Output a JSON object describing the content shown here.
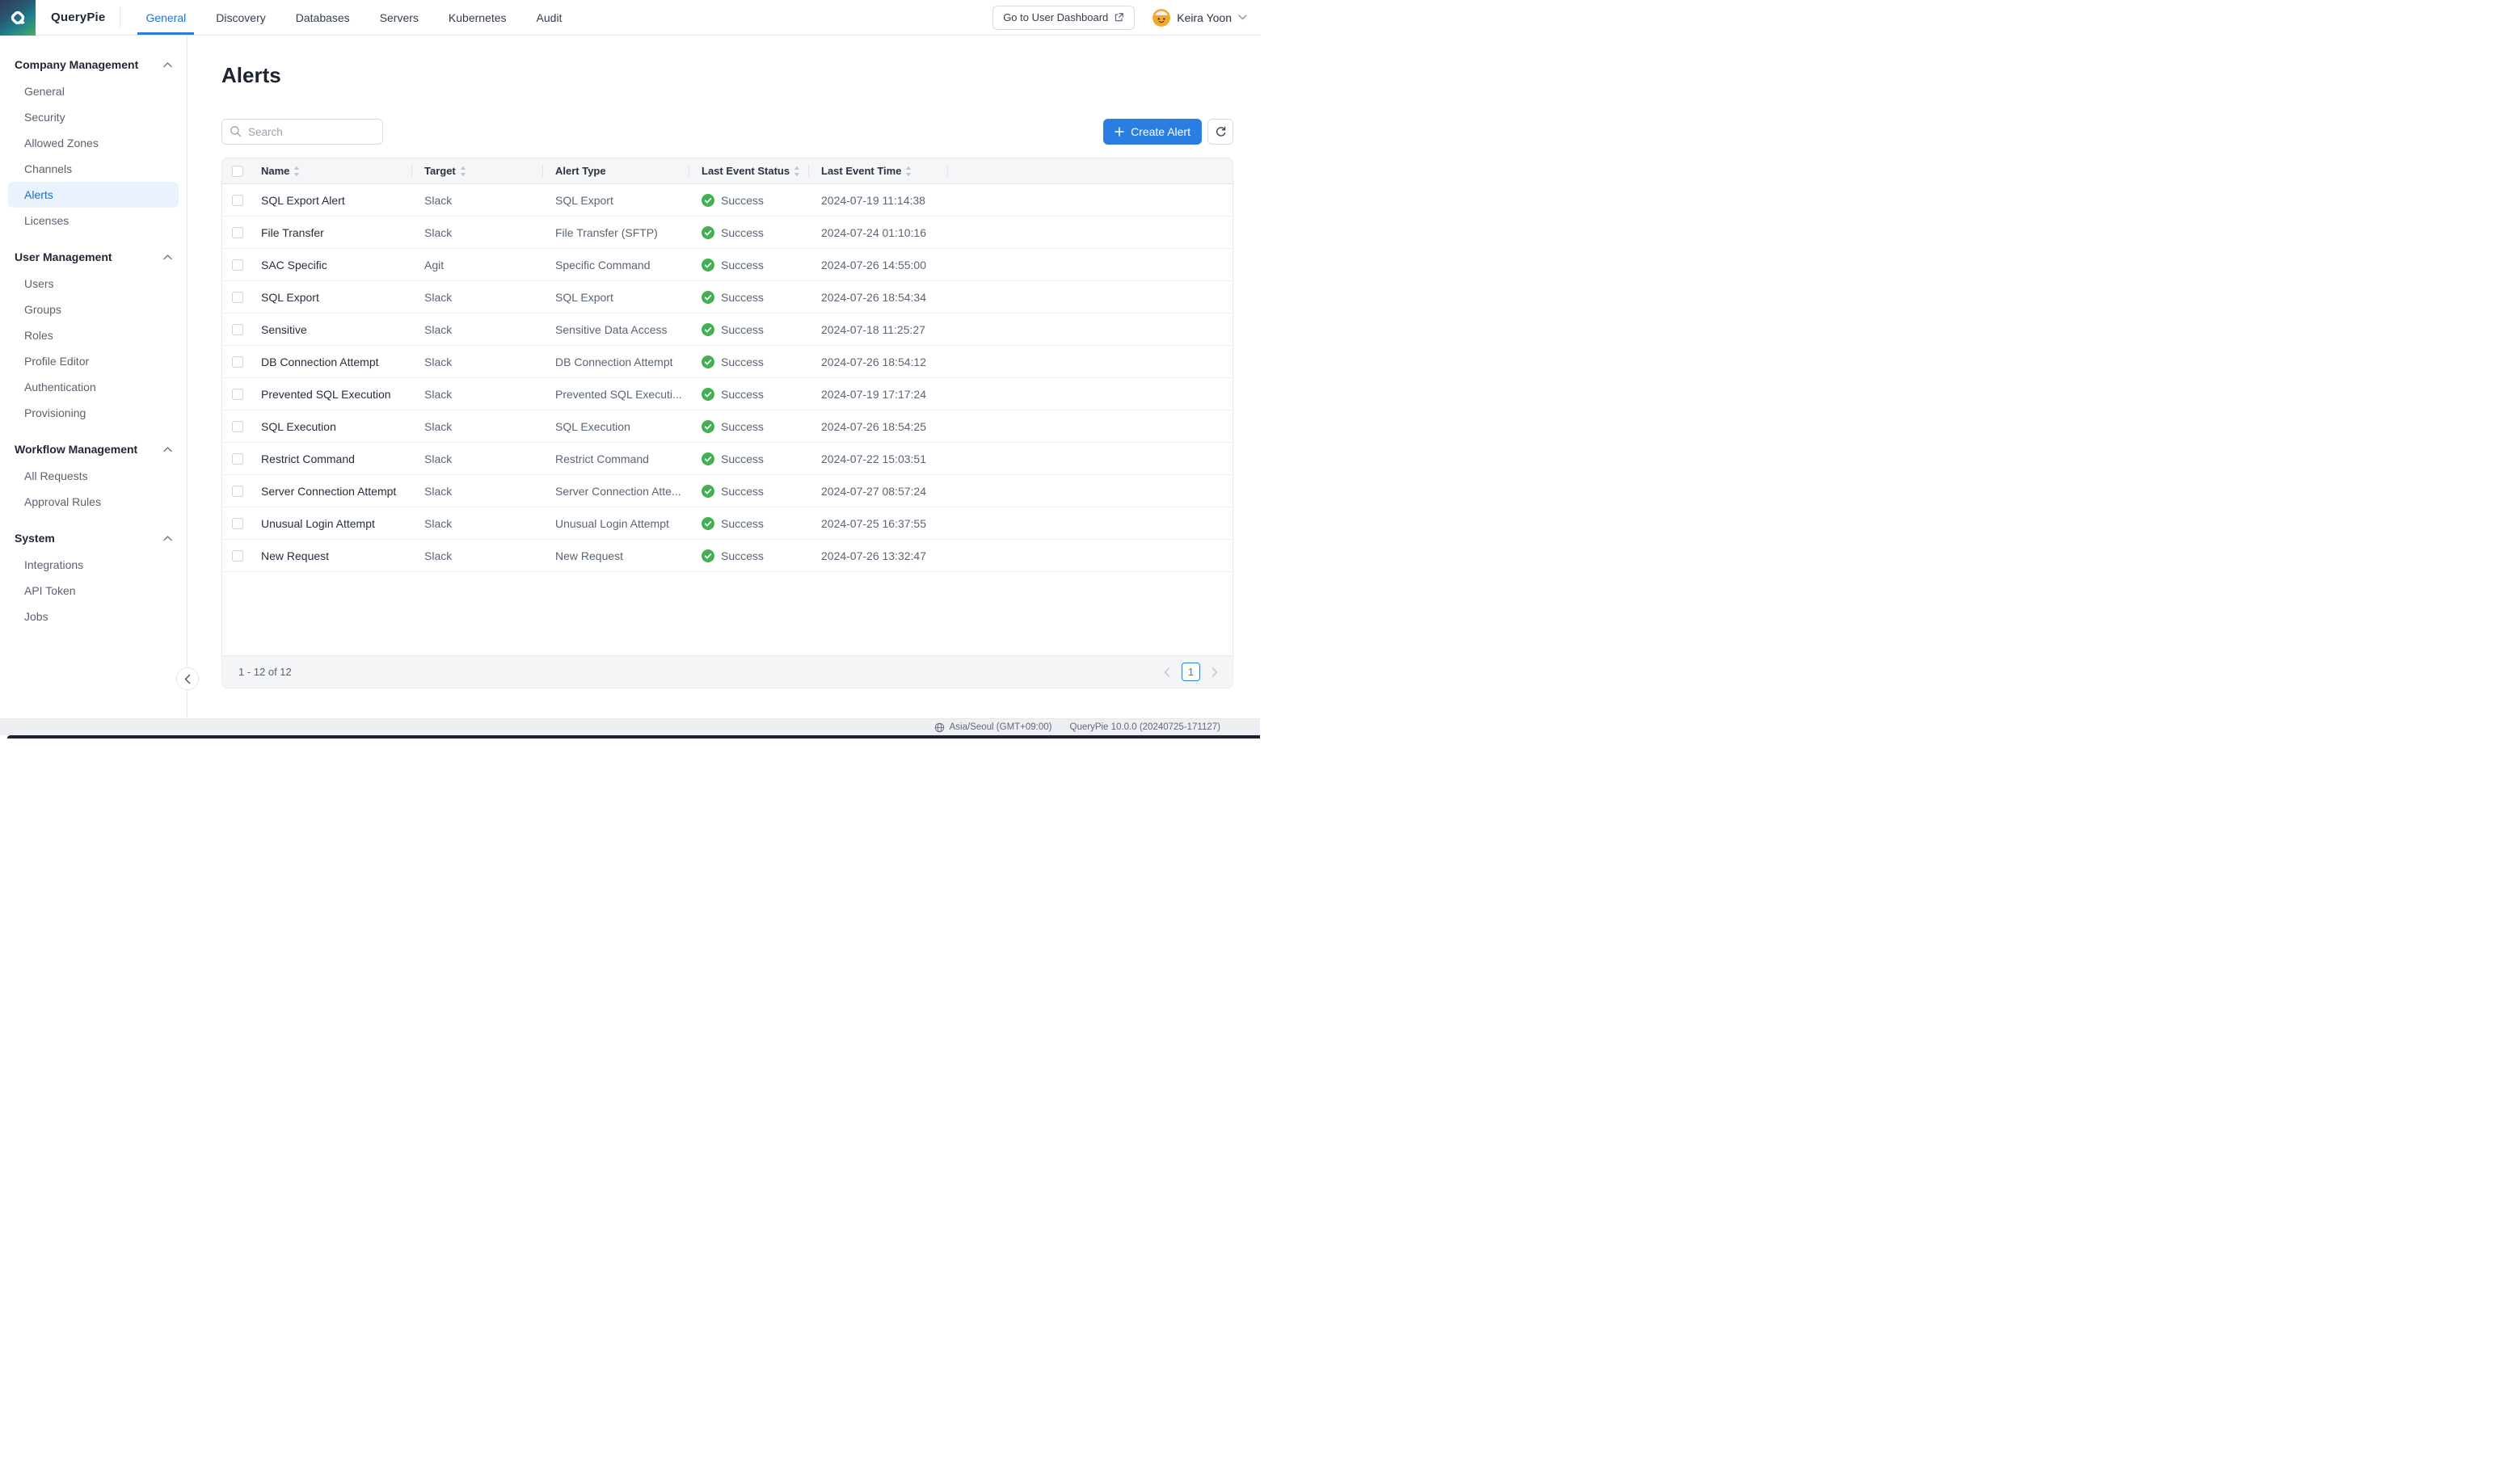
{
  "topbar": {
    "brand": "QueryPie",
    "nav": [
      {
        "label": "General",
        "active": true
      },
      {
        "label": "Discovery",
        "active": false
      },
      {
        "label": "Databases",
        "active": false
      },
      {
        "label": "Servers",
        "active": false
      },
      {
        "label": "Kubernetes",
        "active": false
      },
      {
        "label": "Audit",
        "active": false
      }
    ],
    "dashboard_button": "Go to User Dashboard",
    "user_name": "Keira Yoon"
  },
  "sidebar": {
    "sections": [
      {
        "label": "Company Management",
        "items": [
          {
            "label": "General",
            "active": false
          },
          {
            "label": "Security",
            "active": false
          },
          {
            "label": "Allowed Zones",
            "active": false
          },
          {
            "label": "Channels",
            "active": false
          },
          {
            "label": "Alerts",
            "active": true
          },
          {
            "label": "Licenses",
            "active": false
          }
        ]
      },
      {
        "label": "User Management",
        "items": [
          {
            "label": "Users",
            "active": false
          },
          {
            "label": "Groups",
            "active": false
          },
          {
            "label": "Roles",
            "active": false
          },
          {
            "label": "Profile Editor",
            "active": false
          },
          {
            "label": "Authentication",
            "active": false
          },
          {
            "label": "Provisioning",
            "active": false
          }
        ]
      },
      {
        "label": "Workflow Management",
        "items": [
          {
            "label": "All Requests",
            "active": false
          },
          {
            "label": "Approval Rules",
            "active": false
          }
        ]
      },
      {
        "label": "System",
        "items": [
          {
            "label": "Integrations",
            "active": false
          },
          {
            "label": "API Token",
            "active": false
          },
          {
            "label": "Jobs",
            "active": false
          }
        ]
      }
    ]
  },
  "main": {
    "title": "Alerts",
    "search_placeholder": "Search",
    "create_button_label": "Create Alert",
    "table": {
      "columns": [
        {
          "label": "Name",
          "sortable": true
        },
        {
          "label": "Target",
          "sortable": true
        },
        {
          "label": "Alert Type",
          "sortable": false
        },
        {
          "label": "Last Event Status",
          "sortable": true
        },
        {
          "label": "Last Event Time",
          "sortable": true
        }
      ],
      "rows": [
        {
          "name": "SQL Export Alert",
          "target": "Slack",
          "alert_type": "SQL Export",
          "status": "Success",
          "time": "2024-07-19 11:14:38"
        },
        {
          "name": "File Transfer",
          "target": "Slack",
          "alert_type": "File Transfer (SFTP)",
          "status": "Success",
          "time": "2024-07-24 01:10:16"
        },
        {
          "name": "SAC Specific",
          "target": "Agit",
          "alert_type": "Specific Command",
          "status": "Success",
          "time": "2024-07-26 14:55:00"
        },
        {
          "name": "SQL Export",
          "target": "Slack",
          "alert_type": "SQL Export",
          "status": "Success",
          "time": "2024-07-26 18:54:34"
        },
        {
          "name": "Sensitive",
          "target": "Slack",
          "alert_type": "Sensitive Data Access",
          "status": "Success",
          "time": "2024-07-18 11:25:27"
        },
        {
          "name": "DB Connection Attempt",
          "target": "Slack",
          "alert_type": "DB Connection Attempt",
          "status": "Success",
          "time": "2024-07-26 18:54:12"
        },
        {
          "name": "Prevented SQL Execution",
          "target": "Slack",
          "alert_type": "Prevented SQL Executi...",
          "status": "Success",
          "time": "2024-07-19 17:17:24"
        },
        {
          "name": "SQL Execution",
          "target": "Slack",
          "alert_type": "SQL Execution",
          "status": "Success",
          "time": "2024-07-26 18:54:25"
        },
        {
          "name": "Restrict Command",
          "target": "Slack",
          "alert_type": "Restrict Command",
          "status": "Success",
          "time": "2024-07-22 15:03:51"
        },
        {
          "name": "Server Connection Attempt",
          "target": "Slack",
          "alert_type": "Server Connection Atte...",
          "status": "Success",
          "time": "2024-07-27 08:57:24"
        },
        {
          "name": "Unusual Login Attempt",
          "target": "Slack",
          "alert_type": "Unusual Login Attempt",
          "status": "Success",
          "time": "2024-07-25 16:37:55"
        },
        {
          "name": "New Request",
          "target": "Slack",
          "alert_type": "New Request",
          "status": "Success",
          "time": "2024-07-26 13:32:47"
        }
      ]
    },
    "pagination": {
      "range_label": "1 - 12 of 12",
      "page": "1"
    }
  },
  "statusbar": {
    "timezone": "Asia/Seoul (GMT+09:00)",
    "version": "QueryPie 10.0.0 (20240725-171127)"
  },
  "colors": {
    "accent_blue": "#2a7de1",
    "active_link_blue": "#1b74d3",
    "success_green": "#44b054",
    "avatar_orange": "#f5a623"
  }
}
